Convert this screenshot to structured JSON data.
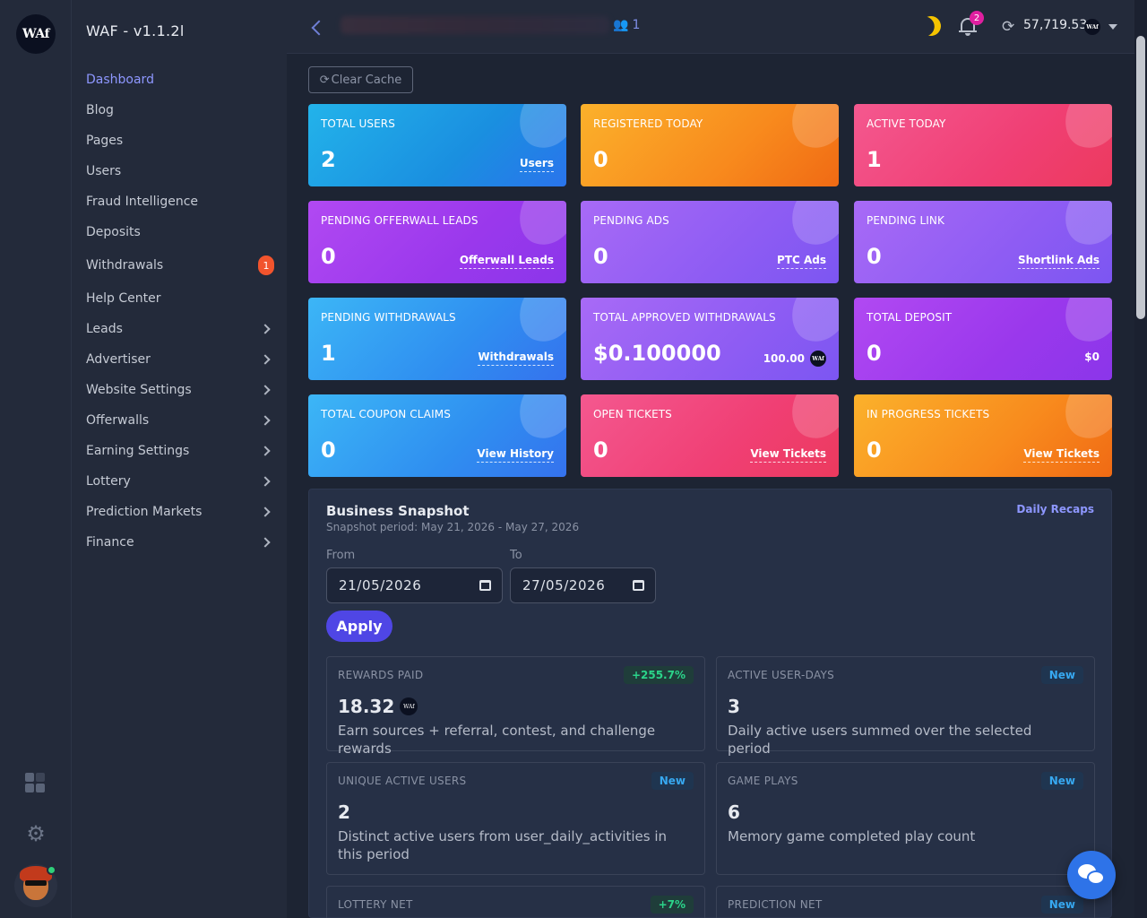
{
  "rail": {
    "logo_text": "WAf",
    "icons": [
      "dashboard-grid-icon",
      "gear-icon",
      "avatar"
    ]
  },
  "sidebar": {
    "brand": "WAF - v1.1.2l",
    "items": [
      {
        "label": "Dashboard",
        "active": true
      },
      {
        "label": "Blog"
      },
      {
        "label": "Pages"
      },
      {
        "label": "Users"
      },
      {
        "label": "Fraud Intelligence"
      },
      {
        "label": "Deposits"
      },
      {
        "label": "Withdrawals",
        "badge": "1"
      },
      {
        "label": "Help Center"
      },
      {
        "label": "Leads",
        "submenu": true
      },
      {
        "label": "Advertiser",
        "submenu": true
      },
      {
        "label": "Website Settings",
        "submenu": true
      },
      {
        "label": "Offerwalls",
        "submenu": true
      },
      {
        "label": "Earning Settings",
        "submenu": true
      },
      {
        "label": "Lottery",
        "submenu": true
      },
      {
        "label": "Prediction Markets",
        "submenu": true
      },
      {
        "label": "Finance",
        "submenu": true
      }
    ]
  },
  "header": {
    "online_count": "1",
    "notification_count": "2",
    "balance": "57,719.53",
    "coin_text": "WAf"
  },
  "toolbar": {
    "clear_cache_label": "Clear Cache"
  },
  "cards": [
    {
      "title": "TOTAL USERS",
      "value": "2",
      "link": "Users"
    },
    {
      "title": "REGISTERED TODAY",
      "value": "0"
    },
    {
      "title": "ACTIVE TODAY",
      "value": "1"
    },
    {
      "title": "PENDING OFFERWALL LEADS",
      "value": "0",
      "link": "Offerwall Leads"
    },
    {
      "title": "PENDING ADS",
      "value": "0",
      "link": "PTC Ads"
    },
    {
      "title": "PENDING LINK",
      "value": "0",
      "link": "Shortlink Ads"
    },
    {
      "title": "PENDING WITHDRAWALS",
      "value": "1",
      "link": "Withdrawals"
    },
    {
      "title": "TOTAL APPROVED WITHDRAWALS",
      "value": "$0.100000",
      "extra": "100.00"
    },
    {
      "title": "TOTAL DEPOSIT",
      "value": "0",
      "extra": "$0"
    },
    {
      "title": "TOTAL COUPON CLAIMS",
      "value": "0",
      "link": "View History"
    },
    {
      "title": "OPEN TICKETS",
      "value": "0",
      "link": "View Tickets"
    },
    {
      "title": "IN PROGRESS TICKETS",
      "value": "0",
      "link": "View Tickets"
    }
  ],
  "snapshot": {
    "title": "Business Snapshot",
    "period": "Snapshot period: May 21, 2026 - May 27, 2026",
    "recaps_link": "Daily Recaps",
    "from_label": "From",
    "to_label": "To",
    "from_value": "21/05/2026",
    "to_value": "27/05/2026",
    "apply_label": "Apply",
    "stats": [
      {
        "title": "REWARDS PAID",
        "badge": "+255.7%",
        "badge_type": "green",
        "value": "18.32",
        "desc": "Earn sources + referral, contest, and challenge rewards"
      },
      {
        "title": "ACTIVE USER-DAYS",
        "badge": "New",
        "badge_type": "blue",
        "value": "3",
        "desc": "Daily active users summed over the selected period"
      },
      {
        "title": "UNIQUE ACTIVE USERS",
        "badge": "New",
        "badge_type": "blue",
        "value": "2",
        "desc": "Distinct active users from user_daily_activities in this period"
      },
      {
        "title": "GAME PLAYS",
        "badge": "New",
        "badge_type": "blue",
        "value": "6",
        "desc": "Memory game completed play count"
      },
      {
        "title": "LOTTERY NET",
        "badge": "+7%",
        "badge_type": "green",
        "value": "",
        "desc": ""
      },
      {
        "title": "PREDICTION NET",
        "badge": "New",
        "badge_type": "blue",
        "value": "",
        "desc": ""
      }
    ]
  }
}
